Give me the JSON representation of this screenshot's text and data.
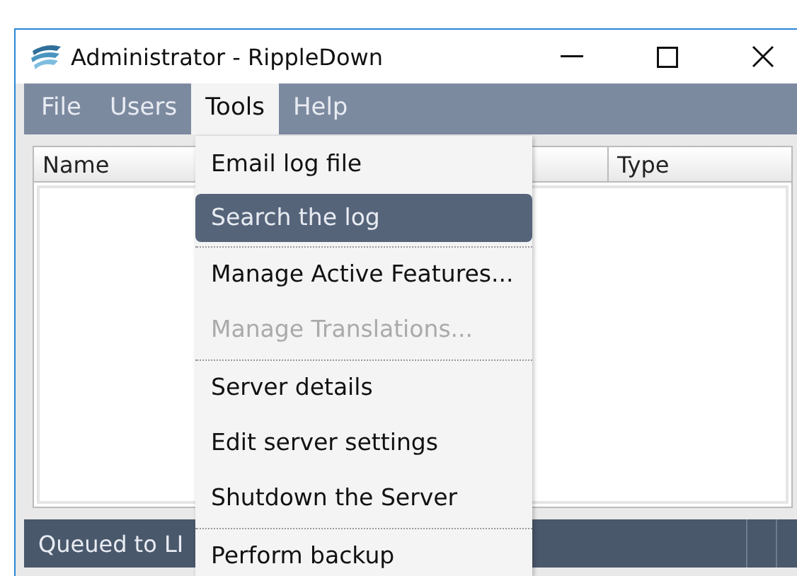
{
  "window": {
    "title": "Administrator - RippleDown"
  },
  "menu_bar": [
    {
      "label": "File",
      "selected": false
    },
    {
      "label": "Users",
      "selected": false
    },
    {
      "label": "Tools",
      "selected": true
    },
    {
      "label": "Help",
      "selected": false
    }
  ],
  "table": {
    "columns": [
      "Name",
      "Type"
    ]
  },
  "dropdown": [
    {
      "kind": "item",
      "label": "Email log file",
      "selected": false,
      "disabled": false
    },
    {
      "kind": "item",
      "label": "Search the log",
      "selected": true,
      "disabled": false
    },
    {
      "kind": "separator"
    },
    {
      "kind": "item",
      "label": "Manage Active Features...",
      "selected": false,
      "disabled": false
    },
    {
      "kind": "item",
      "label": "Manage Translations...",
      "selected": false,
      "disabled": true
    },
    {
      "kind": "separator"
    },
    {
      "kind": "item",
      "label": "Server details",
      "selected": false,
      "disabled": false
    },
    {
      "kind": "item",
      "label": "Edit server settings",
      "selected": false,
      "disabled": false
    },
    {
      "kind": "item",
      "label": "Shutdown the Server",
      "selected": false,
      "disabled": false
    },
    {
      "kind": "separator"
    },
    {
      "kind": "item",
      "label": "Perform backup",
      "selected": false,
      "disabled": false
    }
  ],
  "status_bar": {
    "text": "Queued to LI"
  }
}
